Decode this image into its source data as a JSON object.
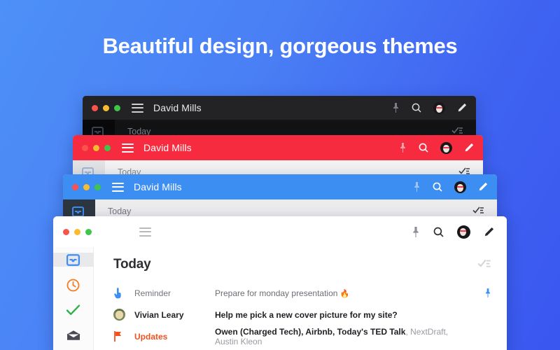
{
  "headline": "Beautiful design, gorgeous themes",
  "theme_colors": {
    "background_start": "#4d90f7",
    "background_end": "#3a57ef",
    "dark_titlebar": "#232326",
    "red_titlebar": "#f72b3f",
    "blue_titlebar": "#3d8ef2",
    "white_titlebar": "#ffffff",
    "accent_orange": "#f4511e",
    "accent_blue": "#3d8ef2",
    "accent_green": "#2fb14a"
  },
  "traffic_lights": {
    "close": "close-light",
    "minimize": "minimize-light",
    "zoom": "zoom-light",
    "close_color": "#f9534c",
    "minimize_color": "#f8bd2e",
    "zoom_color": "#3ec54a"
  },
  "windows": [
    {
      "theme": "dark",
      "title": "David Mills",
      "section_label": "Today",
      "tools": [
        "pin-icon",
        "search-icon",
        "avatar",
        "compose-icon"
      ]
    },
    {
      "theme": "red",
      "title": "David Mills",
      "section_label": "Today",
      "tools": [
        "pin-icon",
        "search-icon",
        "avatar",
        "compose-icon"
      ]
    },
    {
      "theme": "blue",
      "title": "David Mills",
      "section_label": "Today",
      "tools": [
        "pin-icon",
        "search-icon",
        "avatar",
        "compose-icon"
      ]
    }
  ],
  "front_window": {
    "title": "",
    "tools": [
      "pin-icon",
      "search-icon",
      "avatar",
      "compose-icon"
    ],
    "sidebar": [
      {
        "name": "inbox",
        "icon": "inbox-icon",
        "active": true
      },
      {
        "name": "snoozed",
        "icon": "clock-icon",
        "active": false
      },
      {
        "name": "done",
        "icon": "check-icon",
        "active": false
      },
      {
        "name": "mail",
        "icon": "envelope-icon",
        "active": false
      }
    ],
    "section_label": "Today",
    "sort_icon": "check-all-icon",
    "rows": [
      {
        "icon": "hand-pointing-icon",
        "label": "Reminder",
        "label_style": "gray",
        "text": "Prepare for monday presentation",
        "emoji": "🔥",
        "text_style": "gray",
        "pinned": true,
        "pin_icon": "pin-icon"
      },
      {
        "icon": "avatar-photo",
        "label": "Vivian Leary",
        "label_style": "bold",
        "text": "Help me pick a new cover picture for my site?",
        "emoji": "",
        "text_style": "bold",
        "pinned": false,
        "pin_icon": ""
      },
      {
        "icon": "flag-icon",
        "label": "Updates",
        "label_style": "orange",
        "text_bold": "Owen (Charged Tech), Airbnb, Today's TED Talk",
        "text_dim": ", NextDraft, Austin Kleon",
        "text_style": "mixed",
        "pinned": false,
        "pin_icon": ""
      }
    ]
  }
}
